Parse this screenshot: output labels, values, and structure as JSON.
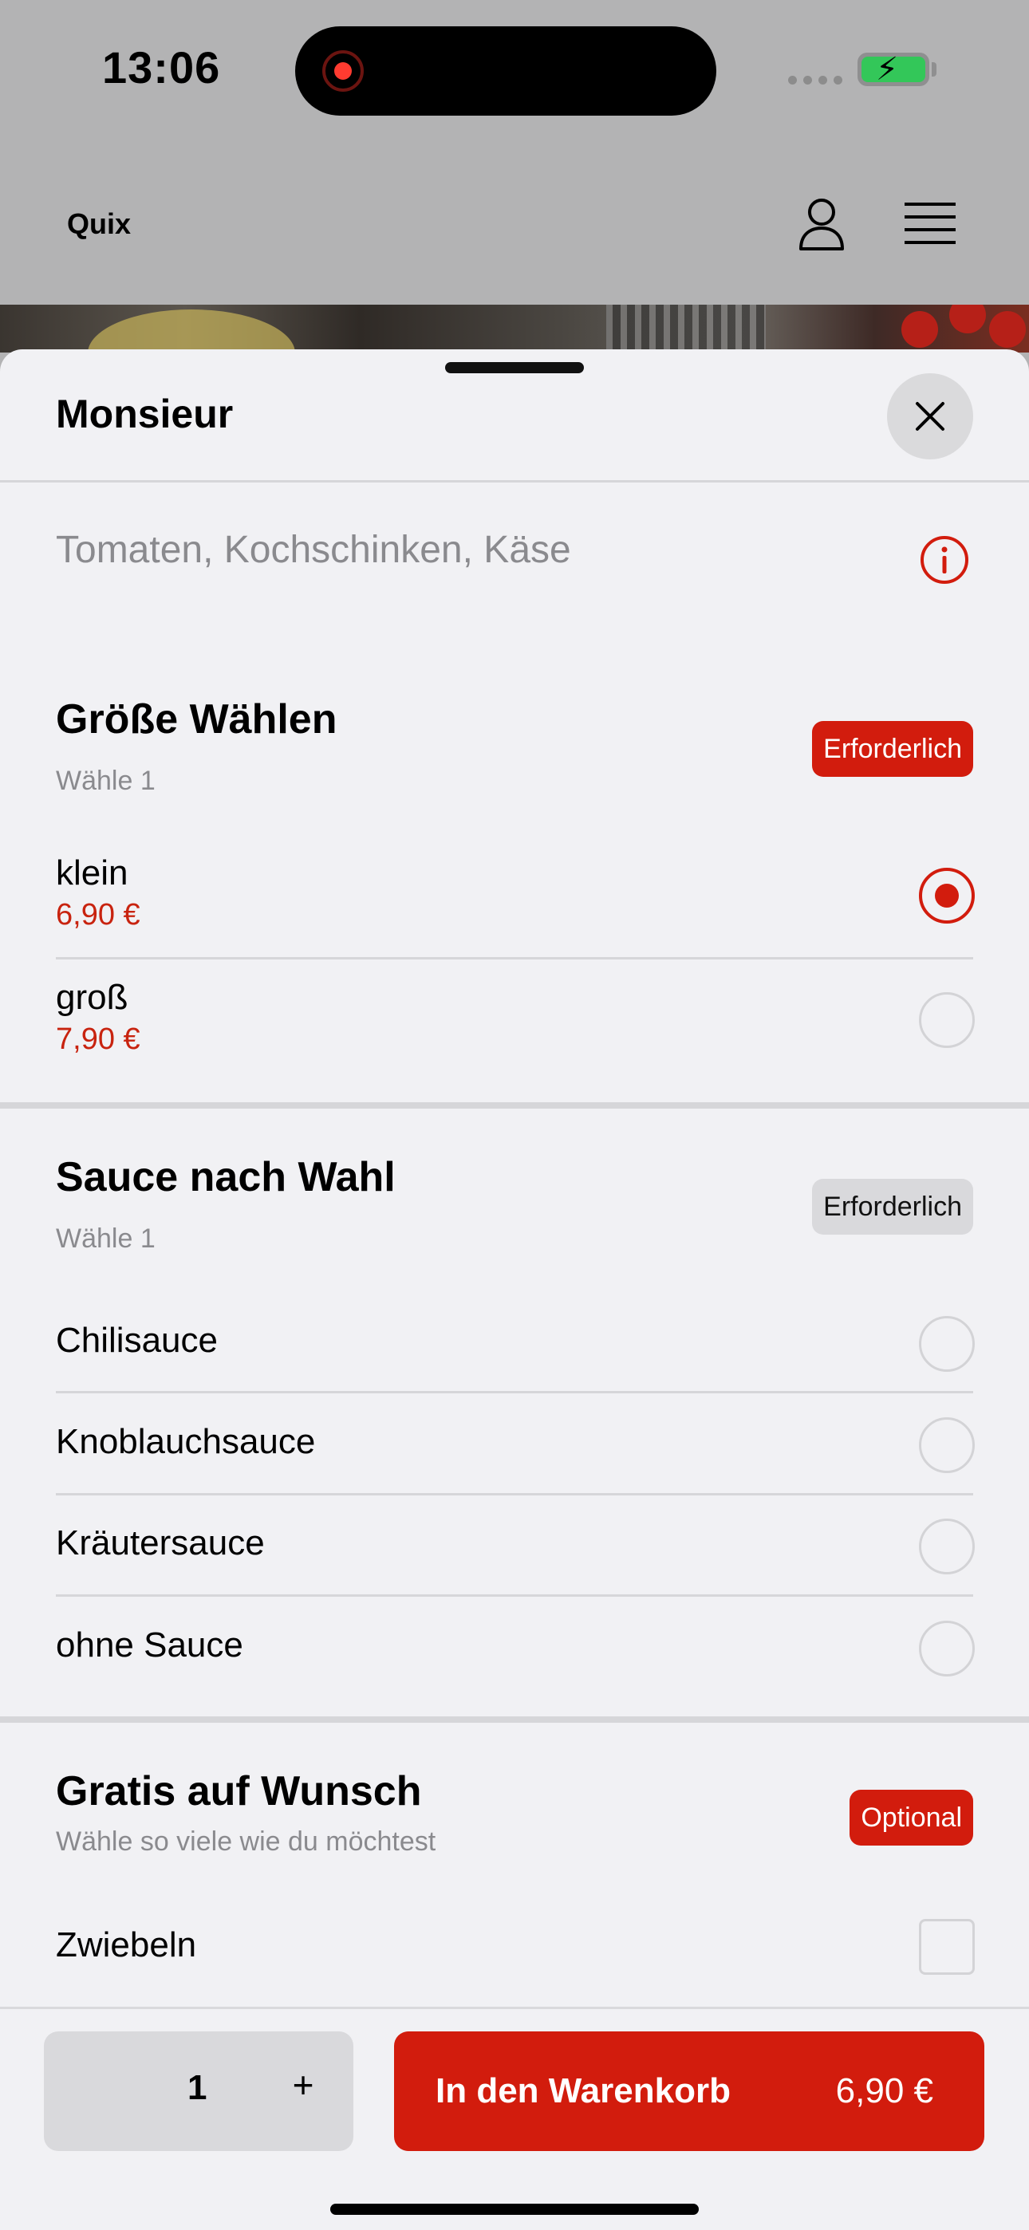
{
  "status_bar": {
    "time": "13:06"
  },
  "header": {
    "brand": "Quix"
  },
  "sheet": {
    "title": "Monsieur",
    "description": "Tomaten, Kochschinken, Käse"
  },
  "groups": [
    {
      "title": "Größe Wählen",
      "subtitle": "Wähle 1",
      "badge": "Erforderlich",
      "options": [
        {
          "label": "klein",
          "price": "6,90 €",
          "selected": true
        },
        {
          "label": "groß",
          "price": "7,90 €",
          "selected": false
        }
      ]
    },
    {
      "title": "Sauce nach Wahl",
      "subtitle": "Wähle 1",
      "badge": "Erforderlich",
      "options": [
        {
          "label": "Chilisauce"
        },
        {
          "label": "Knoblauchsauce"
        },
        {
          "label": "Kräutersauce"
        },
        {
          "label": "ohne Sauce"
        }
      ]
    },
    {
      "title": "Gratis auf Wunsch",
      "subtitle": "Wähle so viele wie du möchtest",
      "badge": "Optional",
      "options": [
        {
          "label": "Zwiebeln",
          "checked": false
        }
      ]
    }
  ],
  "footer": {
    "quantity": "1",
    "plus": "+",
    "cart_label": "In den Warenkorb",
    "cart_price": "6,90 €"
  },
  "colors": {
    "accent": "#d21c0d",
    "price": "#c8230f",
    "sheet_bg": "#f1f1f4"
  }
}
